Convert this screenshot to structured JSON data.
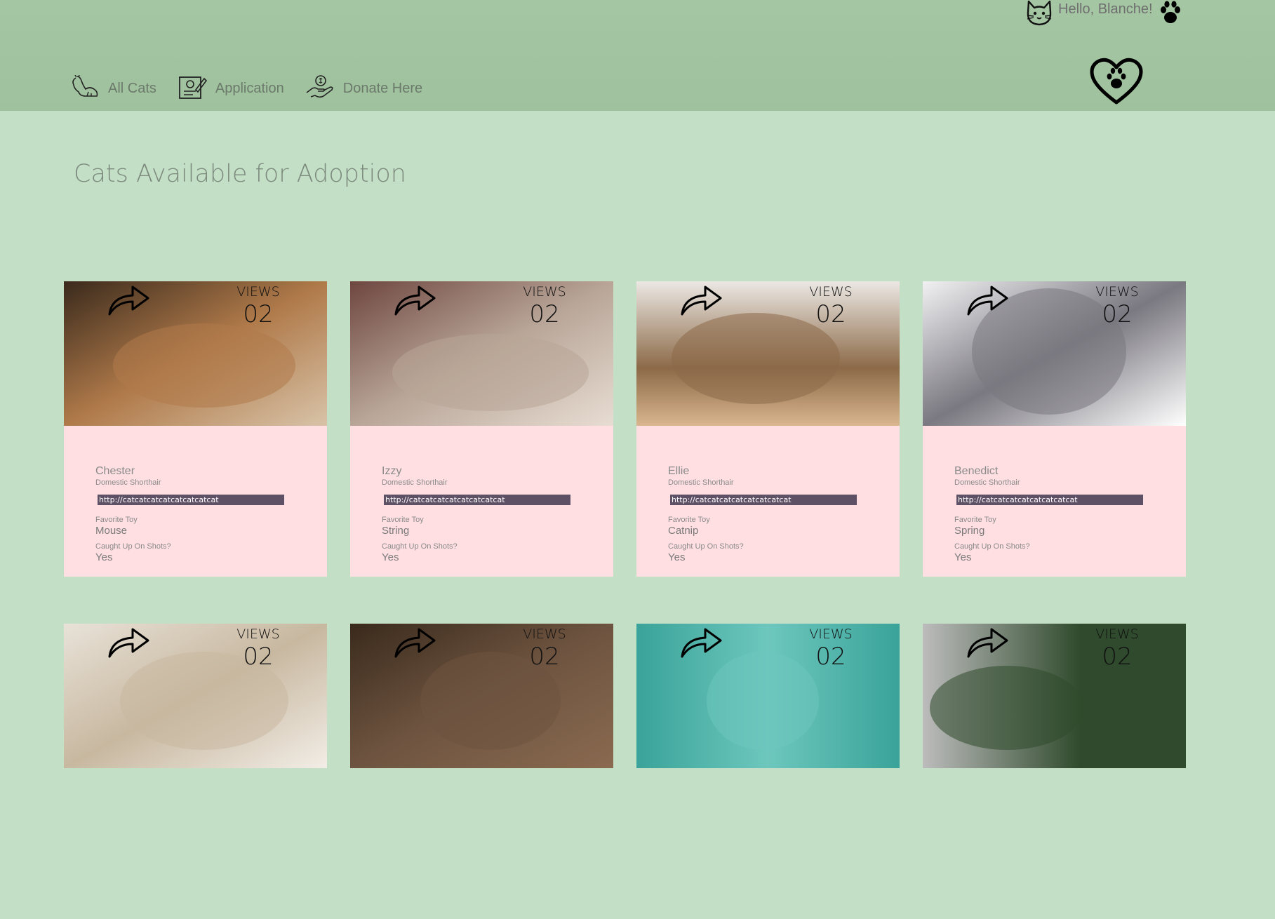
{
  "header": {
    "greeting": "Hello, Blanche!",
    "nav": [
      {
        "label": "All Cats",
        "icon": "cat-icon"
      },
      {
        "label": "Application",
        "icon": "application-form-icon"
      },
      {
        "label": "Donate Here",
        "icon": "donate-hand-icon"
      }
    ]
  },
  "page": {
    "title": "Cats Available for Adoption"
  },
  "labels": {
    "views": "VIEWS",
    "favorite_toy": "Favorite Toy",
    "shots": "Caught Up On Shots?"
  },
  "cats": [
    {
      "name": "Chester",
      "breed": "Domestic Shorthair",
      "link": "http://catcatcatcatcatcatcatcat",
      "views": "02",
      "toy": "Mouse",
      "shots": "Yes",
      "photo_colors": [
        "#3a2a1c",
        "#b07a4a",
        "#d8c3a8"
      ]
    },
    {
      "name": "Izzy",
      "breed": "Domestic Shorthair",
      "link": "http://catcatcatcatcatcatcatcat",
      "views": "02",
      "toy": "String",
      "shots": "Yes",
      "photo_colors": [
        "#6e4640",
        "#b8a597",
        "#e8ddd3"
      ]
    },
    {
      "name": "Ellie",
      "breed": "Domestic Shorthair",
      "link": "http://catcatcatcatcatcatcatcat",
      "views": "02",
      "toy": "Catnip",
      "shots": "Yes",
      "photo_colors": [
        "#ece8e4",
        "#8c6a48",
        "#d9b68f"
      ]
    },
    {
      "name": "Benedict",
      "breed": "Domestic Shorthair",
      "link": "http://catcatcatcatcatcatcatcat",
      "views": "02",
      "toy": "Spring",
      "shots": "Yes",
      "photo_colors": [
        "#f1f1f3",
        "#7a7880",
        "#ffffff"
      ]
    },
    {
      "views": "02",
      "photo_colors": [
        "#e8e2d8",
        "#c8b8a0",
        "#f2ede6"
      ]
    },
    {
      "views": "02",
      "photo_colors": [
        "#3a2a1c",
        "#6e5440",
        "#8a6a50"
      ]
    },
    {
      "views": "02",
      "photo_colors": [
        "#3aa39a",
        "#6dc7bd",
        "#d8782e"
      ]
    },
    {
      "views": "02",
      "photo_colors": [
        "#bcbcbc",
        "#2f4a2c",
        "#e0d8d0"
      ]
    }
  ]
}
